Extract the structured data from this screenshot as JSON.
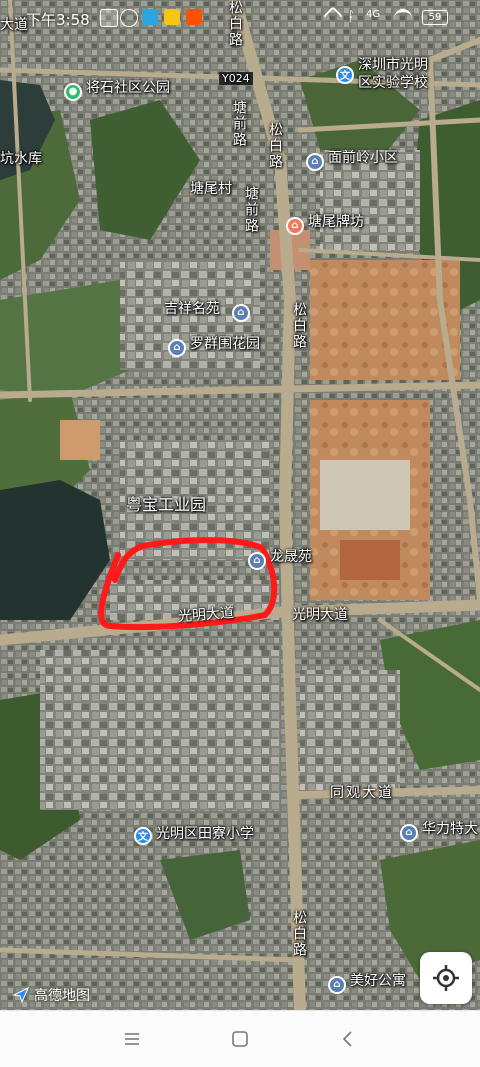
{
  "status_bar": {
    "time": "下午3:58",
    "battery": "59",
    "network": "4G"
  },
  "map": {
    "labels": {
      "top_left_road": "大道",
      "reservoir": "坑水库",
      "jiangshi_park": "将石社区公园",
      "y024": "Y024",
      "shenzhen_school": "深圳市光明区实验学校",
      "shenzhen_school_line1": "深圳市光明",
      "shenzhen_school_line2": "区实验学校",
      "tangqian_road": "塘前路",
      "tangqian_road_2": "塘前路",
      "songbai_road_top": "松白路",
      "songbai_road_mid": "松白路",
      "songbai_road_bottom": "松白路",
      "songbai_road_top2": "松白路",
      "mianqianling": "面前岭小区",
      "tangwei_village": "塘尾村",
      "tangwei_arch": "塘尾牌坊",
      "jixiang": "吉祥名苑",
      "luoqun": "罗群围花园",
      "yuebao": "粤宝工业园",
      "longsheng": "龙晟苑",
      "guangming_avenue_1": "光明大道",
      "guangming_avenue_2": "光明大道",
      "tongguan": "同观大道",
      "huali": "华力特大",
      "tianliao": "光明区田寮小学",
      "meihao": "美好公寓",
      "logo": "高德地图"
    },
    "icons": {
      "park": "park-icon",
      "school": "school-icon",
      "residential": "residential-icon",
      "landmark": "landmark-icon",
      "locate": "locate-icon"
    },
    "colors": {
      "road": "#b8a888",
      "annotation": "#ff1a1a",
      "school_poi": "#2a8cf0",
      "park_poi": "#2cbf6b",
      "landmark_poi": "#f07a5a"
    }
  },
  "nav": {
    "menu": "menu-icon",
    "home": "home-icon",
    "back": "back-icon"
  }
}
